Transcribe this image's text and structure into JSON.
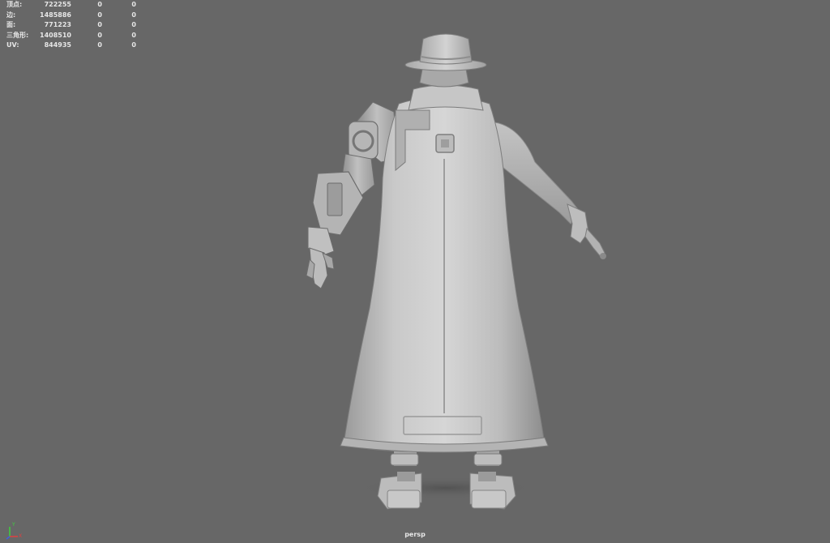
{
  "viewport": {
    "camera": "persp",
    "background": "#676767"
  },
  "hud": {
    "rows": [
      {
        "label": "顶点:",
        "v1": "722255",
        "v2": "0",
        "v3": "0"
      },
      {
        "label": "边:",
        "v1": "1485886",
        "v2": "0",
        "v3": "0"
      },
      {
        "label": "面:",
        "v1": "771223",
        "v2": "0",
        "v3": "0"
      },
      {
        "label": "三角形:",
        "v1": "1408510",
        "v2": "0",
        "v3": "0"
      },
      {
        "label": "UV:",
        "v1": "844935",
        "v2": "0",
        "v3": "0"
      }
    ]
  },
  "axis": {
    "y_label": "Y",
    "x_label": "X",
    "y_color": "#3fd13f",
    "x_color": "#e04040",
    "z_color": "#4060e0"
  }
}
